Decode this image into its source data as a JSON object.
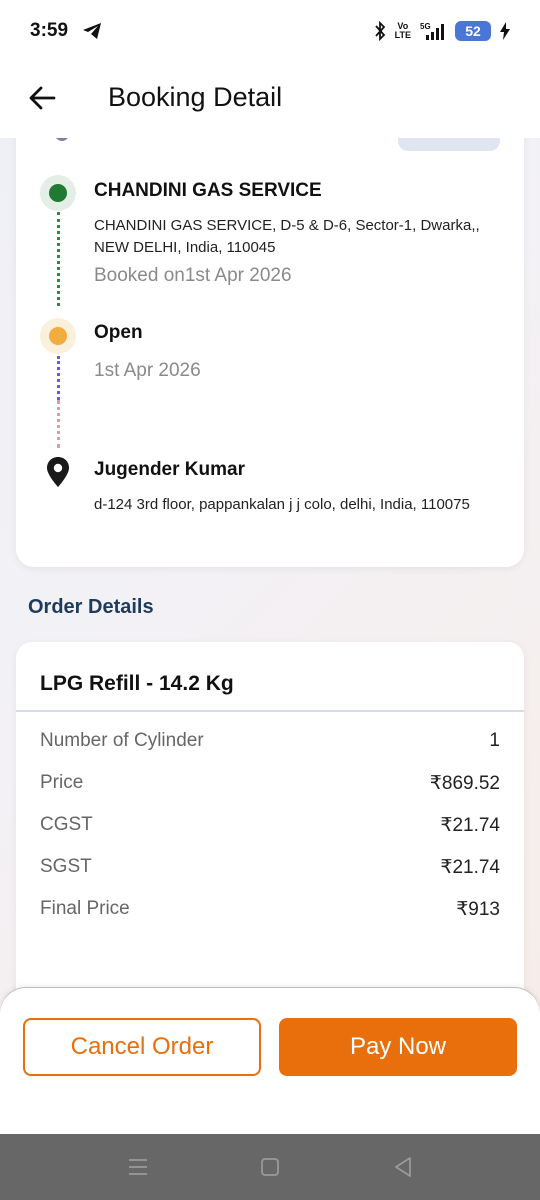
{
  "status_bar": {
    "time": "3:59",
    "volte_top": "Vo",
    "volte_bottom": "LTE",
    "network": "5G",
    "battery": "52"
  },
  "header": {
    "title": "Booking Detail"
  },
  "timeline": {
    "distributor": {
      "name": "CHANDINI GAS SERVICE",
      "address": "CHANDINI GAS SERVICE, D-5 & D-6, Sector-1, Dwarka,, NEW DELHI, India, 110045",
      "booked_on": "Booked on1st Apr 2026"
    },
    "status": {
      "label": "Open",
      "date": "1st Apr 2026"
    },
    "customer": {
      "name": "Jugender Kumar",
      "address": "d-124 3rd floor, pappankalan j j colo, delhi, India, 110075"
    }
  },
  "order_details": {
    "section_title": "Order Details",
    "product": "LPG Refill - 14.2 Kg",
    "rows": [
      {
        "label": "Number of Cylinder",
        "value": "1"
      },
      {
        "label": "Price",
        "value": "₹869.52"
      },
      {
        "label": "CGST",
        "value": "₹21.74"
      },
      {
        "label": "SGST",
        "value": "₹21.74"
      },
      {
        "label": "Final Price",
        "value": "₹913"
      }
    ]
  },
  "actions": {
    "cancel_label": "Cancel Order",
    "pay_label": "Pay Now"
  },
  "colors": {
    "accent": "#e86f0b",
    "status_green": "#1f7a33",
    "status_orange": "#f2ad3e",
    "section_title": "#1d3c5d"
  },
  "icons": [
    "telegram-icon",
    "bluetooth-icon",
    "signal-icon",
    "charging-icon",
    "back-arrow-icon",
    "cylinder-icon",
    "location-pin-icon",
    "menu-icon",
    "home-icon",
    "back-triangle-icon"
  ]
}
